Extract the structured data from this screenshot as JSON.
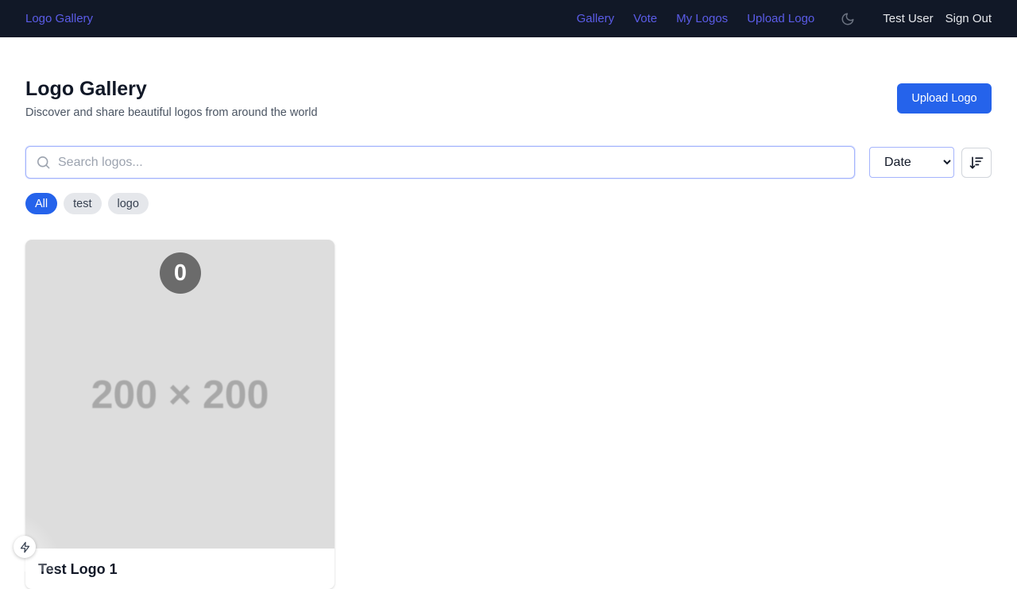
{
  "nav": {
    "brand": "Logo Gallery",
    "links": [
      "Gallery",
      "Vote",
      "My Logos",
      "Upload Logo"
    ],
    "user_name": "Test User",
    "sign_out": "Sign Out",
    "theme_icon": "moon-icon",
    "link_color": "#5b5ce8",
    "bg_color": "#111827"
  },
  "header": {
    "title": "Logo Gallery",
    "subtitle": "Discover and share beautiful logos from around the world",
    "upload_button": "Upload Logo",
    "accent_color": "#2563eb"
  },
  "search": {
    "placeholder": "Search logos...",
    "value": "",
    "icon": "search-icon"
  },
  "sort": {
    "options": [
      "Date"
    ],
    "selected": "Date",
    "direction_icon": "sort-descending-icon"
  },
  "tags": [
    {
      "label": "All",
      "active": true
    },
    {
      "label": "test",
      "active": false
    },
    {
      "label": "logo",
      "active": false
    }
  ],
  "cards": [
    {
      "title": "Test Logo 1",
      "votes": "0",
      "image_placeholder": "200 × 200"
    }
  ],
  "dev_indicator": {
    "icon": "lightning-icon"
  }
}
